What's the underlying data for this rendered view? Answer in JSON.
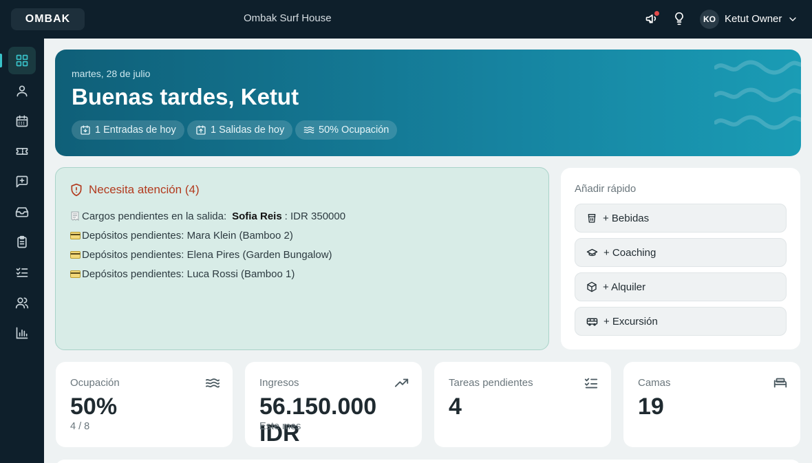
{
  "app": {
    "logo": "OMBAK",
    "property_name": "Ombak Surf House",
    "user_initials": "KO",
    "user_name": "Ketut Owner"
  },
  "sidebar": {
    "items": [
      {
        "name": "dashboard",
        "icon": "grid-icon",
        "active": true
      },
      {
        "name": "guests",
        "icon": "user-icon"
      },
      {
        "name": "calendar",
        "icon": "calendar-icon"
      },
      {
        "name": "tickets",
        "icon": "ticket-icon"
      },
      {
        "name": "messages",
        "icon": "message-plus-icon"
      },
      {
        "name": "inbox",
        "icon": "inbox-icon"
      },
      {
        "name": "clipboard",
        "icon": "clipboard-icon"
      },
      {
        "name": "tasks",
        "icon": "checklist-icon"
      },
      {
        "name": "staff",
        "icon": "users-icon"
      },
      {
        "name": "reports",
        "icon": "bar-chart-icon"
      }
    ]
  },
  "hero": {
    "date": "martes, 28 de julio",
    "greeting": "Buenas tardes, Ketut",
    "chips": [
      {
        "label": "1 Entradas de hoy",
        "icon": "calendar-in-icon"
      },
      {
        "label": "1 Salidas de hoy",
        "icon": "calendar-out-icon"
      },
      {
        "label": "50% Ocupación",
        "icon": "waves-icon"
      }
    ]
  },
  "attention": {
    "title": "Necesita atención (4)",
    "items": [
      {
        "icon": "receipt-emoji",
        "prefix": "Cargos pendientes en la salida:",
        "guest": "Sofia Reis",
        "suffix": ": IDR 350000"
      },
      {
        "icon": "card-emoji",
        "text": "Depósitos pendientes: Mara Klein (Bamboo 2)"
      },
      {
        "icon": "card-emoji",
        "text": "Depósitos pendientes: Elena Pires (Garden Bungalow)"
      },
      {
        "icon": "card-emoji",
        "text": "Depósitos pendientes: Luca Rossi (Bamboo 1)"
      }
    ]
  },
  "quick_add": {
    "title": "Añadir rápido",
    "buttons": [
      {
        "label": "+ Bebidas",
        "icon": "cup-icon"
      },
      {
        "label": "+ Coaching",
        "icon": "graduation-cap-icon"
      },
      {
        "label": "+ Alquiler",
        "icon": "package-icon"
      },
      {
        "label": "+ Excursión",
        "icon": "bus-icon"
      }
    ]
  },
  "stats": [
    {
      "label": "Ocupación",
      "value": "50%",
      "sub": "4 / 8",
      "icon": "waves-icon"
    },
    {
      "label": "Ingresos",
      "value": "56.150.000 IDR",
      "sub": "Este mes",
      "icon": "trending-up-icon"
    },
    {
      "label": "Tareas pendientes",
      "value": "4",
      "sub": "",
      "icon": "checklist-icon"
    },
    {
      "label": "Camas",
      "value": "19",
      "sub": "",
      "icon": "bed-icon"
    }
  ],
  "colors": {
    "nav_bg": "#0e1f2b",
    "hero_start": "#0f5f78",
    "hero_end": "#1a9cb5",
    "attention_bg": "#d8ece7",
    "attention_title": "#b23a1e",
    "accent": "#39c2c9"
  }
}
